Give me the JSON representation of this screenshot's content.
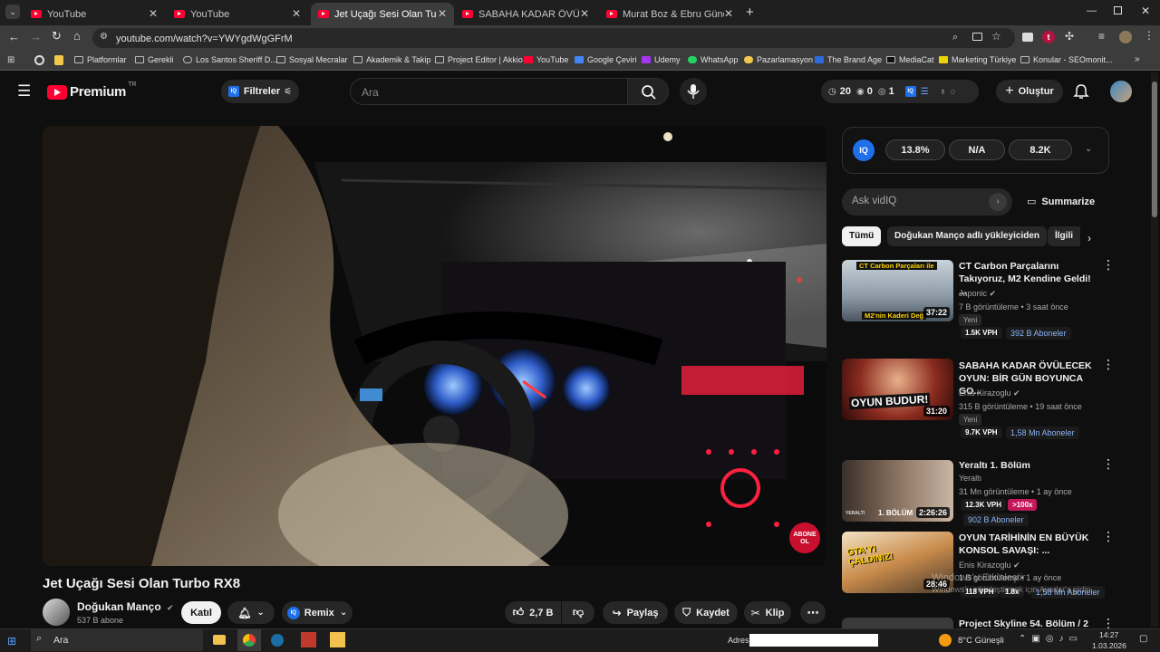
{
  "browser": {
    "tabs": [
      {
        "title": "YouTube"
      },
      {
        "title": "YouTube"
      },
      {
        "title": "Jet Uçağı Sesi Olan Turbo RX8"
      },
      {
        "title": "SABAHA KADAR ÖVÜLECEK OY"
      },
      {
        "title": "Murat Boz & Ebru Gündeş - Gü"
      }
    ],
    "new_tab": "+",
    "url": "youtube.com/watch?v=YWYgdWgGFrM",
    "bookmarks": [
      "Platformlar",
      "Gerekli",
      "Los Santos Sheriff D...",
      "Sosyal Mecralar",
      "Akademik & Takip",
      "Project Editor | Akkio",
      "YouTube",
      "Google Çeviri",
      "Udemy",
      "WhatsApp",
      "Pazarlamasyon",
      "The Brand Age",
      "MediaCat",
      "Marketing Türkiye",
      "Konular - SEOmonit..."
    ]
  },
  "youtube": {
    "logo_text": "Premium",
    "logo_sup": "TR",
    "filters_label": "Filtreler",
    "search_placeholder": "Ara",
    "stats": {
      "a": "20",
      "b": "0",
      "c": "1"
    },
    "create_label": "Oluştur"
  },
  "video": {
    "title": "Jet Uçağı Sesi Olan Turbo RX8",
    "channel": "Doğukan Manço",
    "subscribers": "537 B abone",
    "join_label": "Katıl",
    "remix_label": "Remix",
    "likes": "2,7 B",
    "share_label": "Paylaş",
    "save_label": "Kaydet",
    "clip_label": "Klip",
    "subscribe_overlay": [
      "ABONE",
      "OL"
    ]
  },
  "vidiq": {
    "badge": "IQ",
    "stat1": "13.8%",
    "stat2": "N/A",
    "stat3": "8.2K",
    "ask_placeholder": "Ask vidIQ",
    "summarize_label": "Summarize"
  },
  "chips": [
    "Tümü",
    "Doğukan Manço adlı yükleyiciden",
    "İlgili"
  ],
  "suggestions": [
    {
      "title": "CT Carbon Parçalarını Takıyoruz, M2 Kendine Geldi! ...",
      "channel": "Japonic",
      "stats": "7 B görüntüleme • 3 saat önce",
      "badge": "Yeni",
      "duration": "37:22",
      "vph": "1.5K VPH",
      "subs": "392 B Aboneler",
      "thumb_top": "CT Carbon Parçaları ile",
      "thumb_bottom": "M2'nin Kaderi Değ"
    },
    {
      "title": "SABAHA KADAR ÖVÜLECEK OYUN: BİR GÜN BOYUNCA GO...",
      "channel": "Enis Kirazoglu",
      "stats": "315 B görüntüleme • 19 saat önce",
      "badge": "Yeni",
      "duration": "31:20",
      "vph": "9.7K VPH",
      "subs": "1,58 Mn Aboneler",
      "thumb_top": "OYUN BUDUR!",
      "thumb_bottom": ""
    },
    {
      "title": "Yeraltı 1. Bölüm",
      "channel": "Yeraltı",
      "stats": "31 Mn görüntüleme • 1 ay önce",
      "badge": "",
      "duration": "2:26:26",
      "vph": "12.3K VPH",
      "multiplier": ">100x",
      "subs": "902 B Aboneler",
      "thumb_top": "YERALTI",
      "thumb_bottom": "1. BÖLÜM"
    },
    {
      "title": "OYUN TARİHİNİN EN BÜYÜK KONSOL SAVAŞI: ...",
      "channel": "Enis Kirazoglu",
      "stats": "1 B görüntüleme • 1 ay önce",
      "badge": "",
      "duration": "28:46",
      "vph": "118 VPH",
      "multiplier": "1.8x",
      "subs": "1,58 Mn Aboneler",
      "thumb_top": "GTA'YI ÇALDINIZ!",
      "thumb_bottom": ""
    },
    {
      "title": "Project Skyline 54. Bölüm / 2",
      "channel": "",
      "stats": "",
      "badge": "",
      "duration": "",
      "vph": "",
      "subs": "",
      "thumb_top": "",
      "thumb_bottom": ""
    }
  ],
  "watermark": [
    "Windows'u Etkinleştir",
    "Windows'u etkinleştirmek için Ayarlar'a gidin."
  ],
  "taskbar": {
    "search_label": "Ara",
    "address_label": "Adres",
    "weather": "8°C  Güneşli",
    "time": "14:27",
    "date": "1.03.2026"
  }
}
